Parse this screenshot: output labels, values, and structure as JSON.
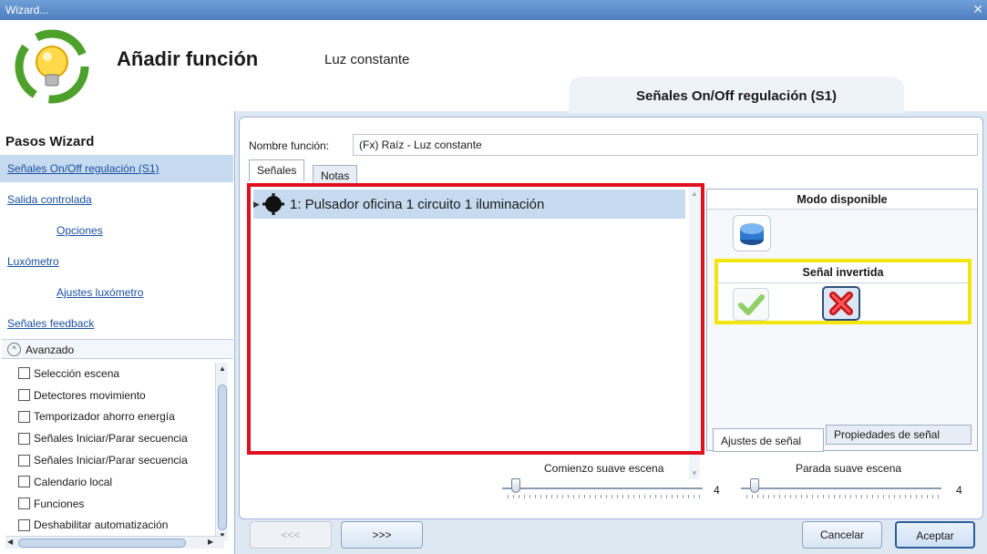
{
  "window": {
    "title": "Wizard...",
    "close": "✕"
  },
  "header": {
    "title": "Añadir función",
    "subtitle": "Luz constante",
    "current_step": "Señales On/Off regulación (S1)"
  },
  "sidebar": {
    "title": "Pasos Wizard",
    "items": [
      {
        "label": "Señales On/Off regulación (S1)"
      },
      {
        "label": "Salida controlada"
      },
      {
        "label": "Opciones"
      },
      {
        "label": "Luxómetro"
      },
      {
        "label": "Ajustes luxómetro"
      },
      {
        "label": "Señales feedback"
      }
    ],
    "advanced": {
      "label": "Avanzado",
      "items": [
        {
          "label": "Selección escena"
        },
        {
          "label": "Detectores movimiento"
        },
        {
          "label": "Temporizador ahorro energía"
        },
        {
          "label": "Señales Iniciar/Parar secuencia"
        },
        {
          "label": "Señales Iniciar/Parar secuencia"
        },
        {
          "label": "Calendario local"
        },
        {
          "label": "Funciones"
        },
        {
          "label": "Deshabilitar automatización"
        }
      ]
    }
  },
  "form": {
    "name_label": "Nombre función:",
    "name_value": "(Fx) Raíz - Luz constante",
    "tabs": [
      {
        "label": "Señales"
      },
      {
        "label": "Notas"
      }
    ],
    "signals": [
      {
        "label": "1: Pulsador oficina 1 circuito 1 iluminación"
      }
    ]
  },
  "side_panel": {
    "mode_title": "Modo disponible",
    "inverted_title": "Señal invertida",
    "tabs": [
      {
        "label": "Ajustes de señal"
      },
      {
        "label": "Propiedades de señal"
      }
    ]
  },
  "sliders": {
    "start": {
      "label": "Comienzo suave escena",
      "value": "4"
    },
    "stop": {
      "label": "Parada suave escena",
      "value": "4"
    }
  },
  "buttons": {
    "back": "<<<",
    "next": ">>>",
    "cancel": "Cancelar",
    "accept": "Aceptar"
  },
  "colors": {
    "highlight_red": "#e0101e",
    "highlight_yellow": "#f2e60e",
    "selection": "#c6dbef"
  }
}
